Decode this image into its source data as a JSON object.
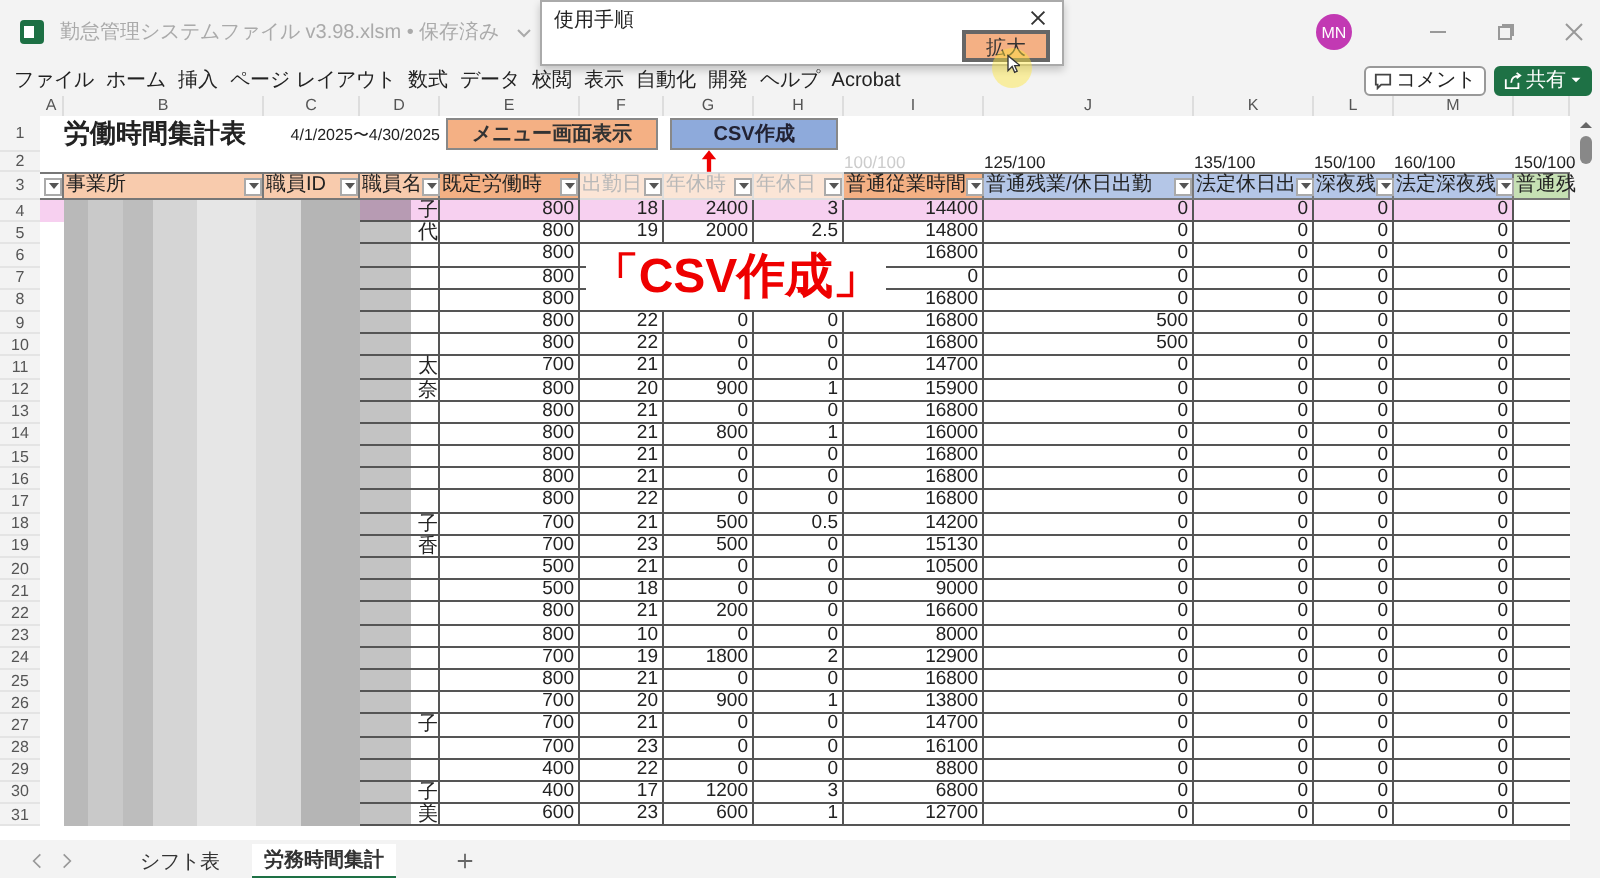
{
  "window": {
    "title": "勤怠管理システムファイル v3.98.xlsm • 保存済み"
  },
  "account": {
    "initials": "MN"
  },
  "dialog": {
    "title": "使用手順",
    "button": "拡大"
  },
  "menu": [
    "ファイル",
    "ホーム",
    "挿入",
    "ページ レイアウト",
    "数式",
    "データ",
    "校閲",
    "表示",
    "自動化",
    "開発",
    "ヘルプ",
    "Acrobat"
  ],
  "toolbar_buttons": [
    {
      "label": "コメント",
      "kind": "comment"
    },
    {
      "label": "共有",
      "kind": "share"
    }
  ],
  "column_letters": [
    "A",
    "B",
    "C",
    "D",
    "E",
    "F",
    "G",
    "H",
    "I",
    "J",
    "K",
    "L",
    "M"
  ],
  "sheet": {
    "row_numbers": [
      "1",
      "2",
      "3"
    ],
    "title": "労働時間集計表",
    "period": "4/1/2025〜4/30/2025",
    "buttons": [
      {
        "label": "メニュー画面表示",
        "kind": "menu"
      },
      {
        "label": "CSV作成",
        "kind": "csv"
      }
    ],
    "rates": [
      {
        "text": "100/100",
        "dimmed": true
      },
      {
        "text": "125/100",
        "dimmed": false
      },
      {
        "text": "135/100",
        "dimmed": false
      },
      {
        "text": "150/100",
        "dimmed": false
      },
      {
        "text": "160/100",
        "dimmed": false
      },
      {
        "text": "150/100",
        "dimmed": false
      }
    ],
    "headers": [
      {
        "color": "#ffffff",
        "dimmed": false,
        "filter": true
      },
      {
        "label": "事業所",
        "color": "#f8cbad",
        "dimmed": false,
        "filter": true
      },
      {
        "label": "職員ID",
        "color": "#f8cbad",
        "dimmed": false,
        "filter": true
      },
      {
        "label": "職員名",
        "color": "#f8cbad",
        "dimmed": false,
        "filter": true
      },
      {
        "label": "既定労働時",
        "color": "#f4b084",
        "dimmed": false,
        "filter": true
      },
      {
        "label": "出勤日",
        "color": "#fbe5d6",
        "dimmed": true,
        "filter": true
      },
      {
        "label": "年休時",
        "color": "#fbe5d6",
        "dimmed": true,
        "filter": true
      },
      {
        "label": "年休日",
        "color": "#fbe5d6",
        "dimmed": true,
        "filter": true
      },
      {
        "label": "普通従業時間",
        "color": "#f4b084",
        "dimmed": false,
        "filter": true
      },
      {
        "label": "普通残業/休日出勤",
        "color": "#b4c6e7",
        "dimmed": false,
        "filter": true
      },
      {
        "label": "法定休日出",
        "color": "#b4c6e7",
        "dimmed": false,
        "filter": true
      },
      {
        "label": "深夜残",
        "color": "#b4c6e7",
        "dimmed": false,
        "filter": true
      },
      {
        "label": "法定深夜残",
        "color": "#b4c6e7",
        "dimmed": false,
        "filter": true
      },
      {
        "label": "普通残",
        "color": "#c6e0b4",
        "dimmed": false,
        "filter": false
      }
    ],
    "rows": [
      {
        "number": "4",
        "selected": true,
        "name": "子",
        "cells": [
          "800",
          "18",
          "2400",
          "3",
          "14400",
          "0",
          "0",
          "0",
          "0"
        ]
      },
      {
        "number": "5",
        "selected": false,
        "name": "代",
        "cells": [
          "800",
          "19",
          "2000",
          "2.5",
          "14800",
          "0",
          "0",
          "0",
          "0"
        ]
      },
      {
        "number": "6",
        "selected": false,
        "cells": [
          "800",
          null,
          null,
          null,
          "16800",
          "0",
          "0",
          "0",
          "0"
        ]
      },
      {
        "number": "7",
        "selected": false,
        "cells": [
          "800",
          null,
          null,
          null,
          "0",
          "0",
          "0",
          "0",
          "0"
        ]
      },
      {
        "number": "8",
        "selected": false,
        "cells": [
          "800",
          null,
          null,
          null,
          "16800",
          "0",
          "0",
          "0",
          "0"
        ]
      },
      {
        "number": "9",
        "selected": false,
        "cells": [
          "800",
          "22",
          "0",
          "0",
          "16800",
          "500",
          "0",
          "0",
          "0"
        ]
      },
      {
        "number": "10",
        "selected": false,
        "cells": [
          "800",
          "22",
          "0",
          "0",
          "16800",
          "500",
          "0",
          "0",
          "0"
        ]
      },
      {
        "number": "11",
        "selected": false,
        "name": "太",
        "cells": [
          "700",
          "21",
          "0",
          "0",
          "14700",
          "0",
          "0",
          "0",
          "0"
        ]
      },
      {
        "number": "12",
        "selected": false,
        "name": "奈",
        "cells": [
          "800",
          "20",
          "900",
          "1",
          "15900",
          "0",
          "0",
          "0",
          "0"
        ]
      },
      {
        "number": "13",
        "selected": false,
        "cells": [
          "800",
          "21",
          "0",
          "0",
          "16800",
          "0",
          "0",
          "0",
          "0"
        ]
      },
      {
        "number": "14",
        "selected": false,
        "cells": [
          "800",
          "21",
          "800",
          "1",
          "16000",
          "0",
          "0",
          "0",
          "0"
        ]
      },
      {
        "number": "15",
        "selected": false,
        "cells": [
          "800",
          "21",
          "0",
          "0",
          "16800",
          "0",
          "0",
          "0",
          "0"
        ]
      },
      {
        "number": "16",
        "selected": false,
        "cells": [
          "800",
          "21",
          "0",
          "0",
          "16800",
          "0",
          "0",
          "0",
          "0"
        ]
      },
      {
        "number": "17",
        "selected": false,
        "cells": [
          "800",
          "22",
          "0",
          "0",
          "16800",
          "0",
          "0",
          "0",
          "0"
        ]
      },
      {
        "number": "18",
        "selected": false,
        "name": "子",
        "cells": [
          "700",
          "21",
          "500",
          "0.5",
          "14200",
          "0",
          "0",
          "0",
          "0"
        ]
      },
      {
        "number": "19",
        "selected": false,
        "name": "香",
        "cells": [
          "700",
          "23",
          "500",
          "0",
          "15130",
          "0",
          "0",
          "0",
          "0"
        ]
      },
      {
        "number": "20",
        "selected": false,
        "cells": [
          "500",
          "21",
          "0",
          "0",
          "10500",
          "0",
          "0",
          "0",
          "0"
        ]
      },
      {
        "number": "21",
        "selected": false,
        "cells": [
          "500",
          "18",
          "0",
          "0",
          "9000",
          "0",
          "0",
          "0",
          "0"
        ]
      },
      {
        "number": "22",
        "selected": false,
        "cells": [
          "800",
          "21",
          "200",
          "0",
          "16600",
          "0",
          "0",
          "0",
          "0"
        ]
      },
      {
        "number": "23",
        "selected": false,
        "cells": [
          "800",
          "10",
          "0",
          "0",
          "8000",
          "0",
          "0",
          "0",
          "0"
        ]
      },
      {
        "number": "24",
        "selected": false,
        "cells": [
          "700",
          "19",
          "1800",
          "2",
          "12900",
          "0",
          "0",
          "0",
          "0"
        ]
      },
      {
        "number": "25",
        "selected": false,
        "cells": [
          "800",
          "21",
          "0",
          "0",
          "16800",
          "0",
          "0",
          "0",
          "0"
        ]
      },
      {
        "number": "26",
        "selected": false,
        "cells": [
          "700",
          "20",
          "900",
          "1",
          "13800",
          "0",
          "0",
          "0",
          "0"
        ]
      },
      {
        "number": "27",
        "selected": false,
        "name": "子",
        "cells": [
          "700",
          "21",
          "0",
          "0",
          "14700",
          "0",
          "0",
          "0",
          "0"
        ]
      },
      {
        "number": "28",
        "selected": false,
        "cells": [
          "700",
          "23",
          "0",
          "0",
          "16100",
          "0",
          "0",
          "0",
          "0"
        ]
      },
      {
        "number": "29",
        "selected": false,
        "cells": [
          "400",
          "22",
          "0",
          "0",
          "8800",
          "0",
          "0",
          "0",
          "0"
        ]
      },
      {
        "number": "30",
        "selected": false,
        "name": "子",
        "cells": [
          "400",
          "17",
          "1200",
          "3",
          "6800",
          "0",
          "0",
          "0",
          "0"
        ]
      },
      {
        "number": "31",
        "selected": false,
        "name": "美",
        "cells": [
          "600",
          "23",
          "600",
          "1",
          "12700",
          "0",
          "0",
          "0",
          "0"
        ]
      }
    ]
  },
  "annotation": {
    "text": "「CSV作成」"
  },
  "sheet_tabs": [
    {
      "label": "シフト表",
      "selected": false
    },
    {
      "label": "労務時間集計",
      "selected": true
    }
  ]
}
